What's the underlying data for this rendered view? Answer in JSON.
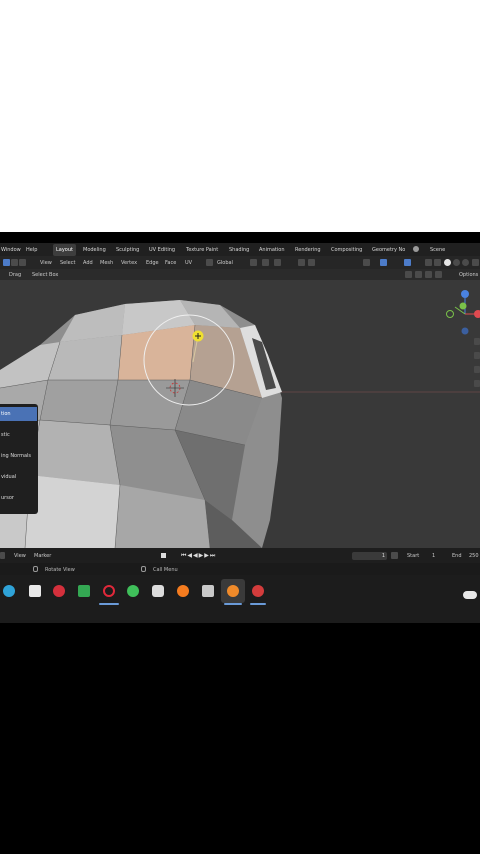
{
  "menubar": {
    "items": [
      "Window",
      "Help"
    ],
    "workspaces": [
      "Layout",
      "Modeling",
      "Sculpting",
      "UV Editing",
      "Texture Paint",
      "Shading",
      "Animation",
      "Rendering",
      "Compositing",
      "Geometry No"
    ],
    "active_workspace": "Layout",
    "scene_label": "Scene"
  },
  "header": {
    "menus": [
      "View",
      "Select",
      "Add",
      "Mesh",
      "Vertex",
      "Edge",
      "Face",
      "UV"
    ],
    "transform_orientation": "Global",
    "options_label": "Options"
  },
  "toolbar": {
    "drag_label": "Drag",
    "select_box_label": "Select Box"
  },
  "operator_popup": {
    "items": [
      "tion",
      "stic",
      "ing Normals",
      "vidual",
      "ursor"
    ],
    "selected_index": 0
  },
  "timeline": {
    "menus": [
      "View",
      "Marker"
    ],
    "current_frame": "1",
    "start_label": "Start",
    "start_value": "1",
    "end_label": "End",
    "end_value": "250"
  },
  "statusbar": {
    "rotate_view": "Rotate View",
    "call_menu": "Call Menu"
  },
  "taskbar": {
    "icons": [
      "edge-icon",
      "folder-icon",
      "pinterest-icon",
      "android-icon",
      "opera-icon",
      "link-icon",
      "shield-icon",
      "firefox-icon",
      "calculator-icon",
      "blender-icon",
      "chrome-icon",
      "cloud-icon"
    ]
  },
  "colors": {
    "accent_blue": "#4a72b5",
    "face_selected": "#e8b896",
    "gizmo_yellow": "#f0e030",
    "axis_x": "#e04a50",
    "axis_y": "#7ac24a",
    "axis_z": "#4a82e0"
  }
}
